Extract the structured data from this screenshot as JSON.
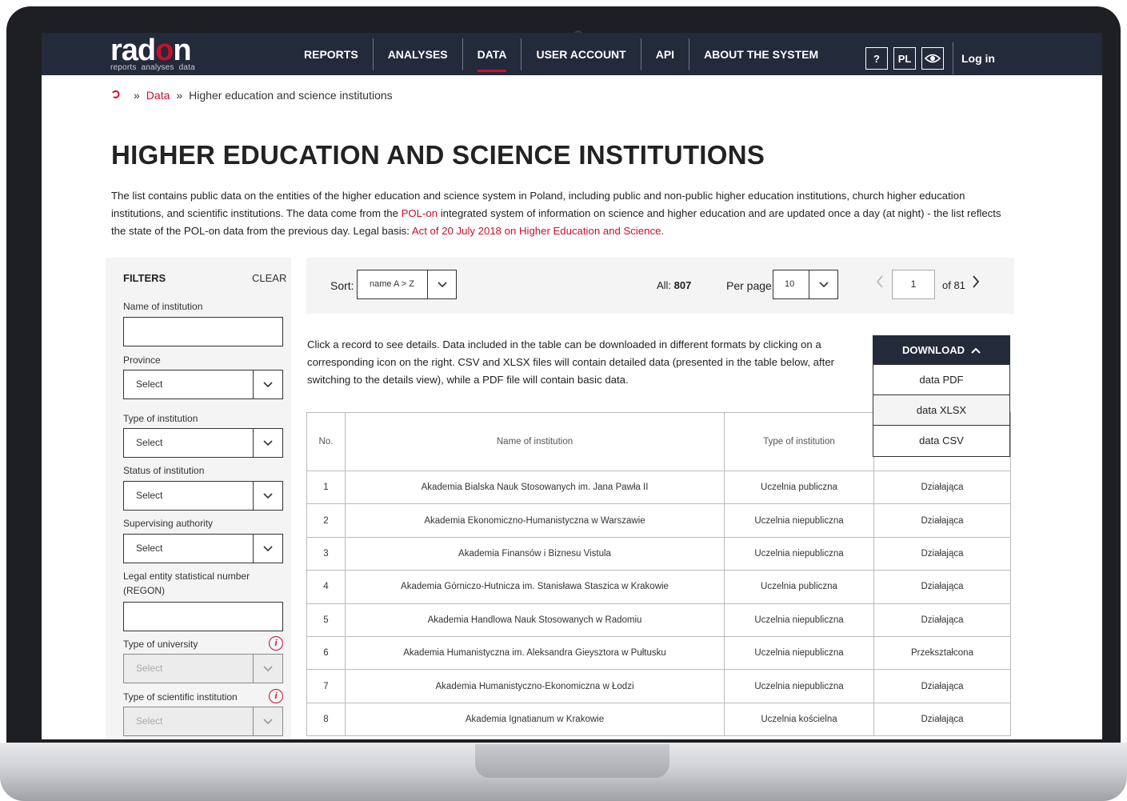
{
  "logo": {
    "word_start": "rad",
    "word_o": "o",
    "word_end": "n",
    "sub": [
      "reports",
      "analyses",
      "data"
    ]
  },
  "nav": {
    "items": [
      {
        "label": "REPORTS",
        "active": false
      },
      {
        "label": "ANALYSES",
        "active": false
      },
      {
        "label": "DATA",
        "active": true
      },
      {
        "label": "USER ACCOUNT",
        "active": false
      },
      {
        "label": "API",
        "active": false
      },
      {
        "label": "ABOUT THE SYSTEM",
        "active": false
      }
    ],
    "help": "?",
    "lang": "PL",
    "login": "Log in"
  },
  "breadcrumb": {
    "home_icon": "radon-home-icon",
    "sep": "»",
    "link": "Data",
    "current": "Higher education and science institutions"
  },
  "page_title": "HIGHER EDUCATION AND SCIENCE INSTITUTIONS",
  "intro": {
    "p1": "The list contains public data on the entities of the higher education and science system in Poland, including public and non-public higher education institutions, church higher education institutions, and scientific institutions. The data come from the ",
    "link1": "POL-on",
    "p2": " integrated system of information on science and higher education and are updated once a day (at night) - the list reflects the state of the POL-on data from the previous day. Legal basis: ",
    "link2": "Act of 20 July 2018 on Higher Education and Science",
    "p3": "."
  },
  "filters": {
    "title": "FILTERS",
    "clear": "CLEAR",
    "name_label": "Name of institution",
    "province_label": "Province",
    "province_value": "Select",
    "type_label": "Type of institution",
    "type_value": "Select",
    "status_label": "Status of institution",
    "status_value": "Select",
    "authority_label": "Supervising authority",
    "authority_value": "Select",
    "regon_label_1": "Legal entity statistical number",
    "regon_label_2": "(REGON)",
    "university_label": "Type of university",
    "university_value": "Select",
    "scientific_label": "Type of scientific institution",
    "scientific_value": "Select"
  },
  "toolbar": {
    "sort_label": "Sort:",
    "sort_value": "name A > Z",
    "all_label": "All: ",
    "all_count": "807",
    "perpage_label": "Per page:",
    "perpage_value": "10",
    "page": "1",
    "of_pages": "of 81"
  },
  "notice": "Click a record to see details. Data included in the table can be downloaded in different formats by clicking on a corresponding icon on the right. CSV and XLSX files will contain detailed data (presented in the table below, after switching to the details view), while a PDF file will contain basic data.",
  "download": {
    "label": "DOWNLOAD",
    "options": [
      "data PDF",
      "data XLSX",
      "data CSV"
    ]
  },
  "table": {
    "headers": [
      "No.",
      "Name of institution",
      "Type of institution",
      ""
    ],
    "rows": [
      [
        "1",
        "Akademia Bialska Nauk Stosowanych im. Jana Pawła II",
        "Uczelnia publiczna",
        "Działająca"
      ],
      [
        "2",
        "Akademia Ekonomiczno-Humanistyczna w Warszawie",
        "Uczelnia niepubliczna",
        "Działająca"
      ],
      [
        "3",
        "Akademia Finansów i Biznesu Vistula",
        "Uczelnia niepubliczna",
        "Działająca"
      ],
      [
        "4",
        "Akademia Górniczo-Hutnicza im. Stanisława Staszica w Krakowie",
        "Uczelnia publiczna",
        "Działająca"
      ],
      [
        "5",
        "Akademia Handlowa Nauk Stosowanych w Radomiu",
        "Uczelnia niepubliczna",
        "Działająca"
      ],
      [
        "6",
        "Akademia Humanistyczna im. Aleksandra Gieysztora w Pułtusku",
        "Uczelnia niepubliczna",
        "Przekształcona"
      ],
      [
        "7",
        "Akademia Humanistyczno-Ekonomiczna w Łodzi",
        "Uczelnia niepubliczna",
        "Działająca"
      ],
      [
        "8",
        "Akademia Ignatianum w Krakowie",
        "Uczelnia kościelna",
        "Działająca"
      ]
    ]
  },
  "colors": {
    "accent": "#c8102e",
    "nav_bg": "#232a3a",
    "panel_bg": "#f4f4f5"
  }
}
